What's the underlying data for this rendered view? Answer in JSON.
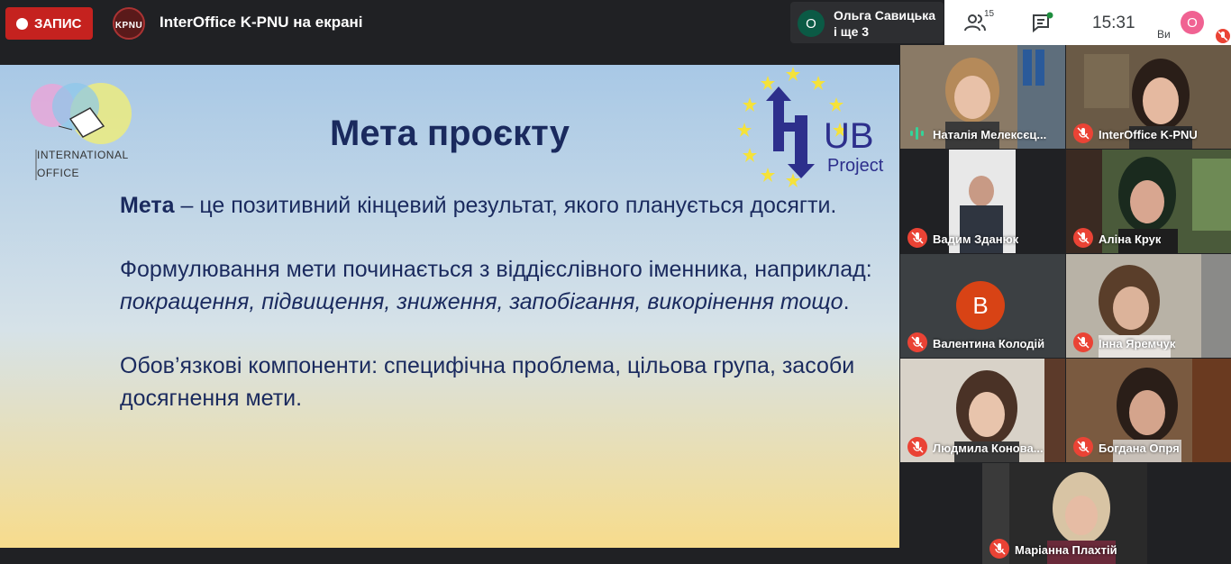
{
  "topbar": {
    "record_label": "ЗАПИС",
    "org_logo_text": "KPNU",
    "presenting_title": "InterOffice K-PNU на екрані",
    "presenter": {
      "avatar_letter": "О",
      "name_line1": "Ольга Савицька",
      "name_line2": "і ще 3"
    }
  },
  "rightbar": {
    "participants_count": "15",
    "time": "15:31",
    "self_avatar_letter": "О",
    "self_label": "Ви"
  },
  "slide": {
    "title": "Мета проєкту",
    "logo_left_line1": "INTERNATIONAL",
    "logo_left_line2": "OFFICE",
    "logo_right_word": "UB",
    "logo_right_sub": "Project",
    "para1_bold": "Мета",
    "para1_rest": " – це позитивний кінцевий результат,  якого планується  досягти.",
    "para2_plain": "Формулювання мети починається з віддієслівного іменника, наприклад: ",
    "para2_italic": "покращення, підвищення, зниження, запобігання, викорінення  тощо",
    "para2_end": ".",
    "para3": "Обов’язкові компоненти: специфічна проблема, цільова група, засоби досягнення мети."
  },
  "participants": [
    {
      "name": "Наталія Мелексєць",
      "display": "Наталія Мелексєц..."
    },
    {
      "name": "InterOffice K-PNU"
    },
    {
      "name": "Вадим Зданюк"
    },
    {
      "name": "Аліна Крук"
    },
    {
      "name": "Валентина Колодій",
      "avatar_letter": "В"
    },
    {
      "name": "Інна Яремчук"
    },
    {
      "name": "Людмила Конова...",
      "display": "Людмила Конова..."
    },
    {
      "name": "Богдана Опря"
    },
    {
      "name": "Маріанна Плахтій"
    }
  ],
  "colors": {
    "record": "#c5221f",
    "muted": "#ea4335",
    "title_text": "#1a2a5e",
    "presenter_avatar": "#0b5a45",
    "self_avatar": "#f06292"
  }
}
